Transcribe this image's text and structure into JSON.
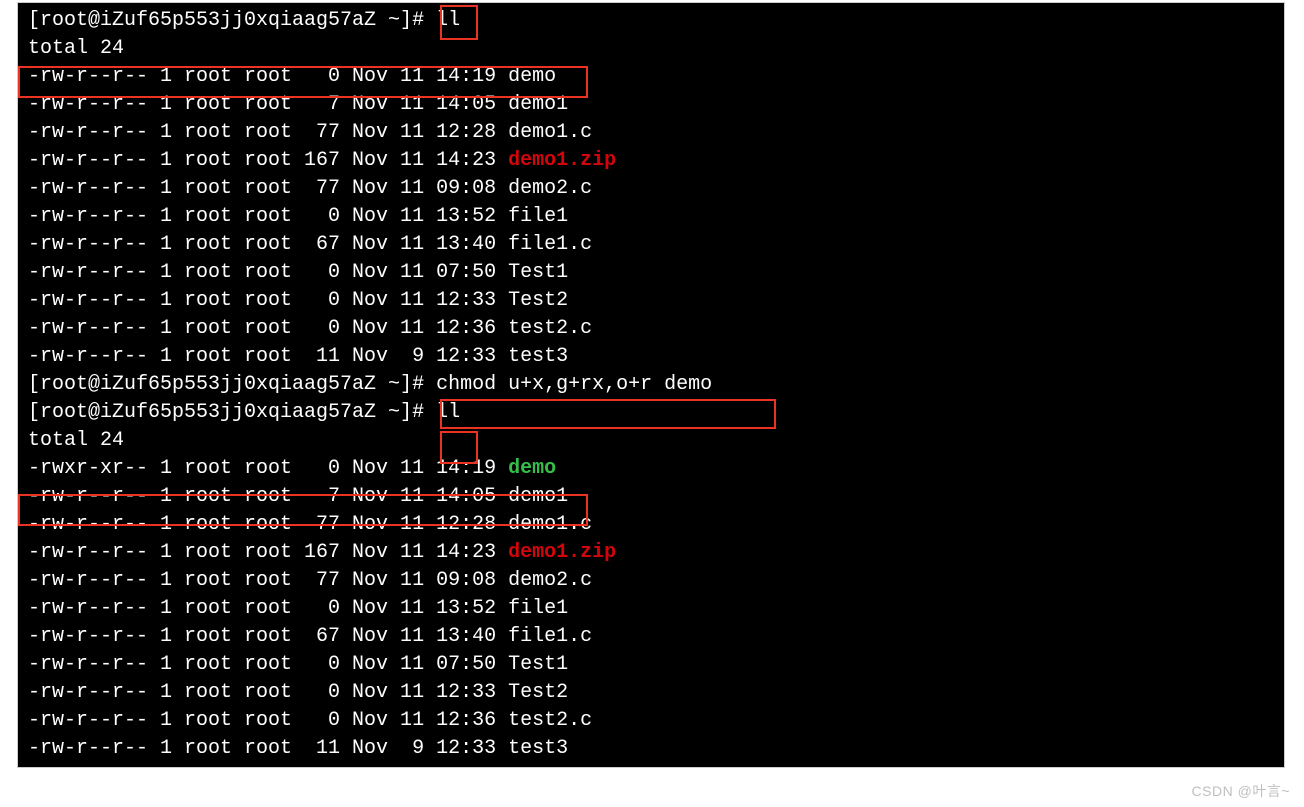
{
  "prompt": "[root@iZuf65p553jj0xqiaag57aZ ~]# ",
  "commands": {
    "ll": "ll",
    "chmod": "chmod u+x,g+rx,o+r demo"
  },
  "total_line": "total 24",
  "listing_before": [
    {
      "perm": "-rw-r--r--",
      "link": "1",
      "owner": "root",
      "group": "root",
      "size": "0",
      "date": "Nov 11 14:19",
      "name": "demo",
      "kind": "plain"
    },
    {
      "perm": "-rw-r--r--",
      "link": "1",
      "owner": "root",
      "group": "root",
      "size": "7",
      "date": "Nov 11 14:05",
      "name": "demo1",
      "kind": "plain"
    },
    {
      "perm": "-rw-r--r--",
      "link": "1",
      "owner": "root",
      "group": "root",
      "size": "77",
      "date": "Nov 11 12:28",
      "name": "demo1.c",
      "kind": "plain"
    },
    {
      "perm": "-rw-r--r--",
      "link": "1",
      "owner": "root",
      "group": "root",
      "size": "167",
      "date": "Nov 11 14:23",
      "name": "demo1.zip",
      "kind": "red"
    },
    {
      "perm": "-rw-r--r--",
      "link": "1",
      "owner": "root",
      "group": "root",
      "size": "77",
      "date": "Nov 11 09:08",
      "name": "demo2.c",
      "kind": "plain"
    },
    {
      "perm": "-rw-r--r--",
      "link": "1",
      "owner": "root",
      "group": "root",
      "size": "0",
      "date": "Nov 11 13:52",
      "name": "file1",
      "kind": "plain"
    },
    {
      "perm": "-rw-r--r--",
      "link": "1",
      "owner": "root",
      "group": "root",
      "size": "67",
      "date": "Nov 11 13:40",
      "name": "file1.c",
      "kind": "plain"
    },
    {
      "perm": "-rw-r--r--",
      "link": "1",
      "owner": "root",
      "group": "root",
      "size": "0",
      "date": "Nov 11 07:50",
      "name": "Test1",
      "kind": "plain"
    },
    {
      "perm": "-rw-r--r--",
      "link": "1",
      "owner": "root",
      "group": "root",
      "size": "0",
      "date": "Nov 11 12:33",
      "name": "Test2",
      "kind": "plain"
    },
    {
      "perm": "-rw-r--r--",
      "link": "1",
      "owner": "root",
      "group": "root",
      "size": "0",
      "date": "Nov 11 12:36",
      "name": "test2.c",
      "kind": "plain"
    },
    {
      "perm": "-rw-r--r--",
      "link": "1",
      "owner": "root",
      "group": "root",
      "size": "11",
      "date": "Nov  9 12:33",
      "name": "test3",
      "kind": "plain"
    }
  ],
  "listing_after": [
    {
      "perm": "-rwxr-xr--",
      "link": "1",
      "owner": "root",
      "group": "root",
      "size": "0",
      "date": "Nov 11 14:19",
      "name": "demo",
      "kind": "green"
    },
    {
      "perm": "-rw-r--r--",
      "link": "1",
      "owner": "root",
      "group": "root",
      "size": "7",
      "date": "Nov 11 14:05",
      "name": "demo1",
      "kind": "plain"
    },
    {
      "perm": "-rw-r--r--",
      "link": "1",
      "owner": "root",
      "group": "root",
      "size": "77",
      "date": "Nov 11 12:28",
      "name": "demo1.c",
      "kind": "plain"
    },
    {
      "perm": "-rw-r--r--",
      "link": "1",
      "owner": "root",
      "group": "root",
      "size": "167",
      "date": "Nov 11 14:23",
      "name": "demo1.zip",
      "kind": "red"
    },
    {
      "perm": "-rw-r--r--",
      "link": "1",
      "owner": "root",
      "group": "root",
      "size": "77",
      "date": "Nov 11 09:08",
      "name": "demo2.c",
      "kind": "plain"
    },
    {
      "perm": "-rw-r--r--",
      "link": "1",
      "owner": "root",
      "group": "root",
      "size": "0",
      "date": "Nov 11 13:52",
      "name": "file1",
      "kind": "plain"
    },
    {
      "perm": "-rw-r--r--",
      "link": "1",
      "owner": "root",
      "group": "root",
      "size": "67",
      "date": "Nov 11 13:40",
      "name": "file1.c",
      "kind": "plain"
    },
    {
      "perm": "-rw-r--r--",
      "link": "1",
      "owner": "root",
      "group": "root",
      "size": "0",
      "date": "Nov 11 07:50",
      "name": "Test1",
      "kind": "plain"
    },
    {
      "perm": "-rw-r--r--",
      "link": "1",
      "owner": "root",
      "group": "root",
      "size": "0",
      "date": "Nov 11 12:33",
      "name": "Test2",
      "kind": "plain"
    },
    {
      "perm": "-rw-r--r--",
      "link": "1",
      "owner": "root",
      "group": "root",
      "size": "0",
      "date": "Nov 11 12:36",
      "name": "test2.c",
      "kind": "plain"
    },
    {
      "perm": "-rw-r--r--",
      "link": "1",
      "owner": "root",
      "group": "root",
      "size": "11",
      "date": "Nov  9 12:33",
      "name": "test3",
      "kind": "plain"
    }
  ],
  "watermark": "CSDN @叶言~"
}
